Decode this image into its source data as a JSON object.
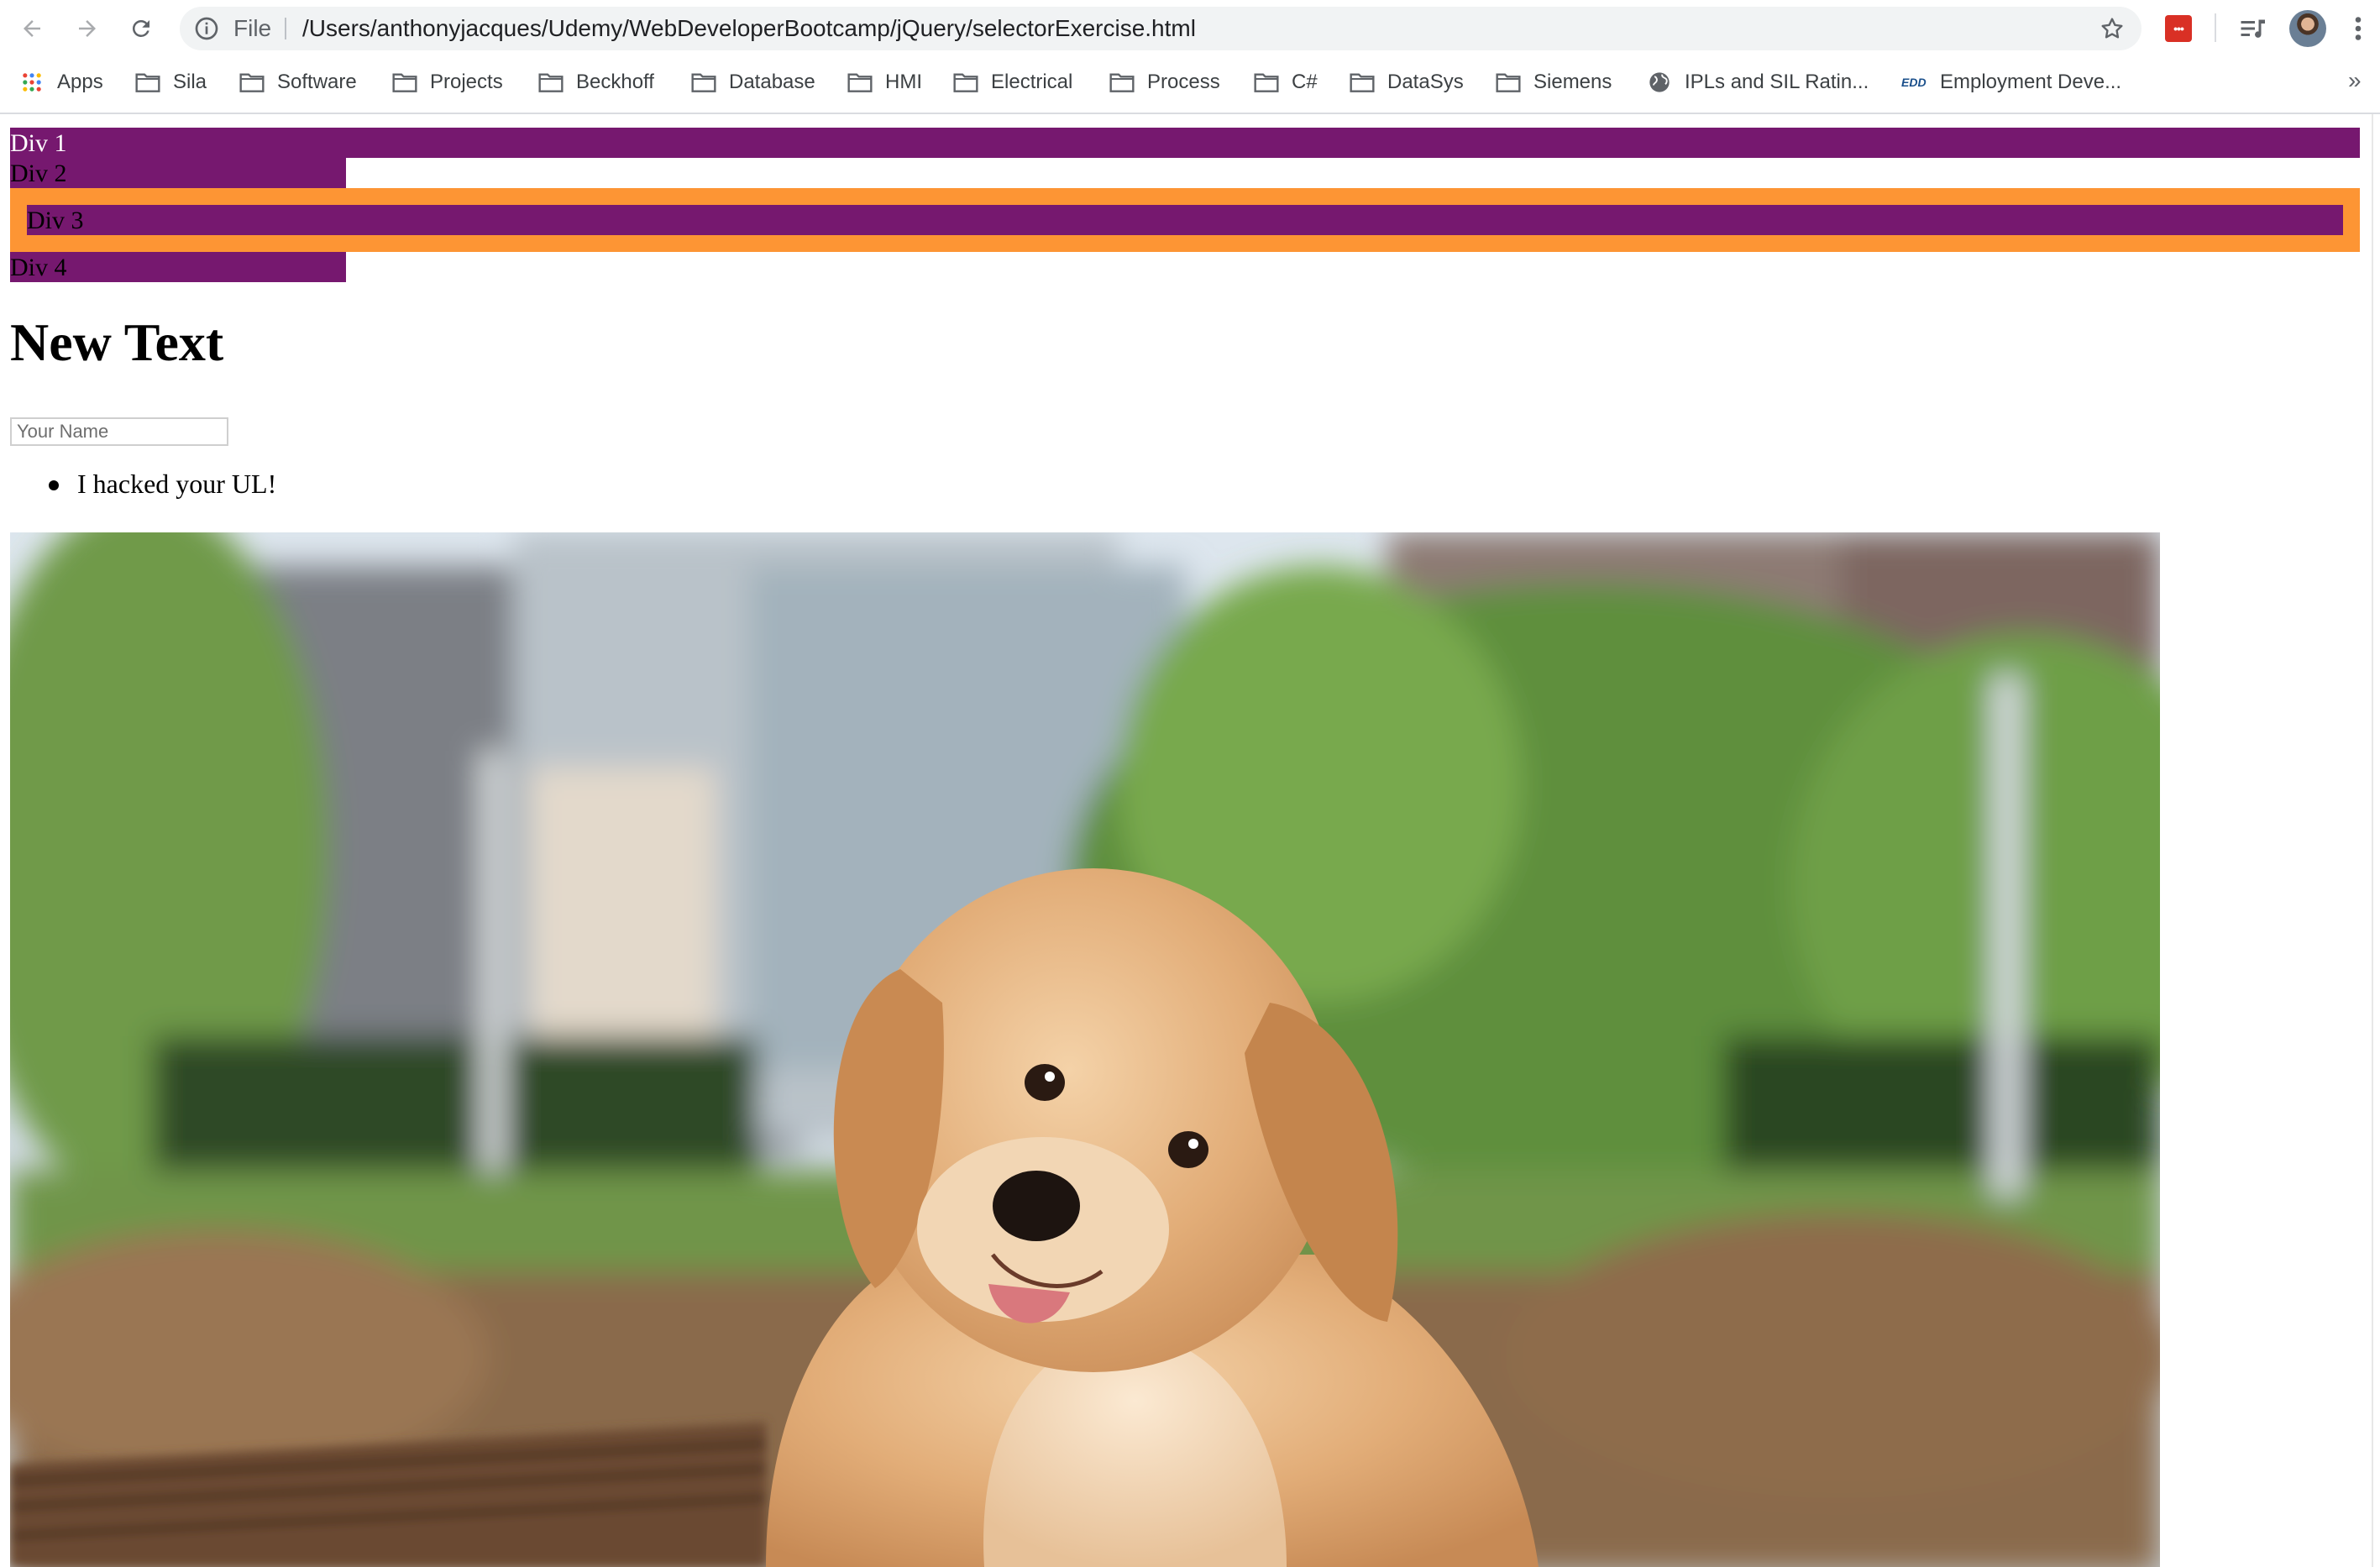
{
  "browser": {
    "url_scheme": "File",
    "url": "/Users/anthonyjacques/Udemy/WebDeveloperBootcamp/jQuery/selectorExercise.html",
    "bookmarks": [
      {
        "label": "Apps",
        "icon": "apps-grid-icon"
      },
      {
        "label": "Sila",
        "icon": "folder-icon"
      },
      {
        "label": "Software",
        "icon": "folder-icon"
      },
      {
        "label": "Projects",
        "icon": "folder-icon"
      },
      {
        "label": "Beckhoff",
        "icon": "folder-icon"
      },
      {
        "label": "Database",
        "icon": "folder-icon"
      },
      {
        "label": "HMI",
        "icon": "folder-icon"
      },
      {
        "label": "Electrical",
        "icon": "folder-icon"
      },
      {
        "label": "Process",
        "icon": "folder-icon"
      },
      {
        "label": "C#",
        "icon": "folder-icon"
      },
      {
        "label": "DataSys",
        "icon": "folder-icon"
      },
      {
        "label": "Siemens",
        "icon": "folder-icon"
      },
      {
        "label": "IPLs and SIL Ratin...",
        "icon": "globe-icon"
      },
      {
        "label": "Employment Deve...",
        "icon": "edd-logo-icon"
      }
    ],
    "overflow_label": "»",
    "extension_badge": "•••",
    "edd_badge": "EDD"
  },
  "page": {
    "div1": "Div 1",
    "div2": "Div 2",
    "div3": "Div 3",
    "div4": "Div 4",
    "heading": "New Text",
    "name_input_placeholder": "Your Name",
    "list_items": [
      "I hacked your UL!"
    ],
    "image": "golden-retriever-puppy-photo"
  },
  "colors": {
    "div_purple": "#76186f",
    "div3_orange": "#fd9534",
    "omnibox_bg": "#f1f3f4",
    "extension_red": "#d93025"
  }
}
